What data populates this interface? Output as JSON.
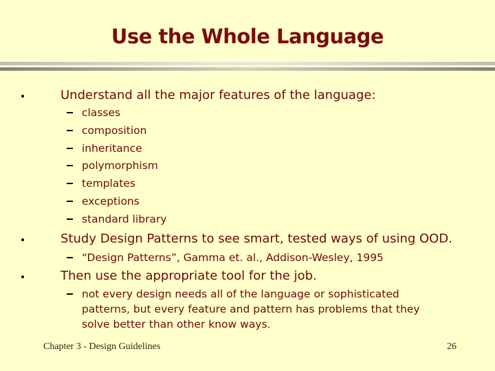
{
  "slide": {
    "title": "Use the Whole Language",
    "bullets": [
      {
        "text": "Understand all the major features of the language:",
        "subitems": [
          "classes",
          "composition",
          "inheritance",
          "polymorphism",
          "templates",
          "exceptions",
          "standard library"
        ]
      },
      {
        "text": "Study Design Patterns to see smart, tested ways of using OOD.",
        "subitems": [
          "“Design Patterns”, Gamma et. al., Addison-Wesley, 1995"
        ]
      },
      {
        "text": "Then use the appropriate tool for the job.",
        "subitems": [
          "not every design needs all of the language or sophisticated patterns, but every feature and pattern has problems that they solve better than other know ways."
        ]
      }
    ],
    "footer": {
      "chapter": "Chapter 3 - Design Guidelines",
      "page_number": "26"
    },
    "colors": {
      "background": "#ffffcc",
      "title": "#7a0c0c",
      "body_text": "#6b0a0a"
    }
  }
}
